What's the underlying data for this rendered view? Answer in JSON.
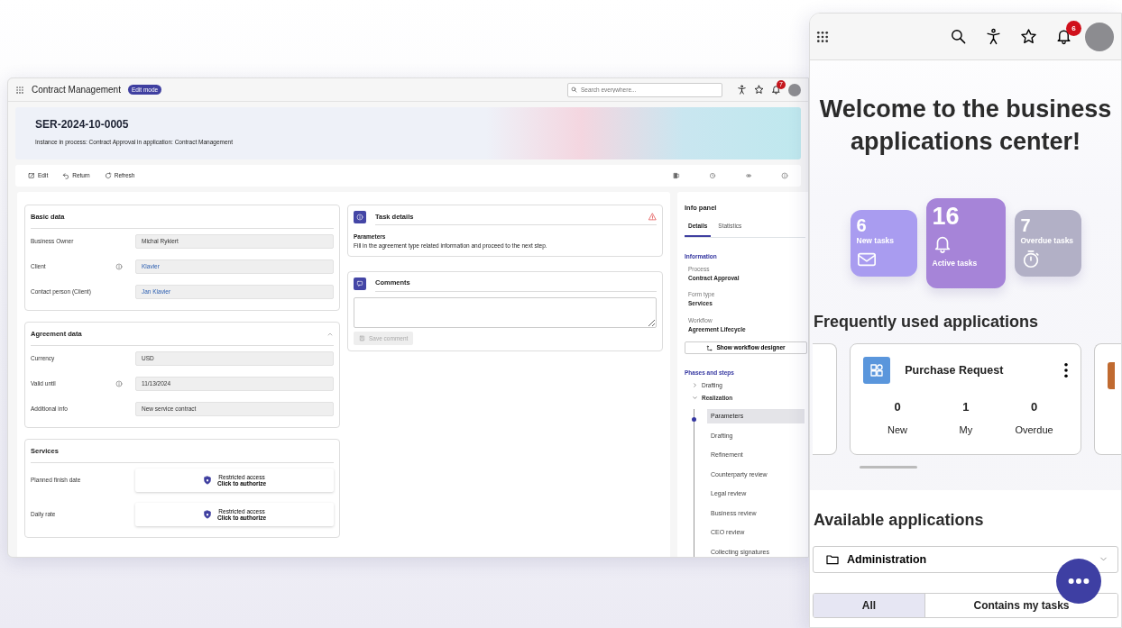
{
  "app_window": {
    "title": "Contract Management",
    "mode_badge": "Edit mode",
    "search": {
      "placeholder": "Search everywhere..."
    },
    "notification_count": "7"
  },
  "record": {
    "title": "SER-2024-10-0005",
    "subtitle": "Instance in process: Contract Approval in application: Contract Management"
  },
  "toolbar": [
    {
      "kind": "edit",
      "label": "Edit"
    },
    {
      "kind": "return",
      "label": "Return"
    },
    {
      "kind": "refresh",
      "label": "Refresh"
    }
  ],
  "sections": [
    {
      "title": "Basic data",
      "fields": [
        {
          "label": "Business Owner",
          "kind": "text",
          "info": false,
          "value": "Michal Rykiert"
        },
        {
          "label": "Client",
          "kind": "link",
          "info": true,
          "value": "Klavier"
        },
        {
          "label": "Contact person (Client)",
          "kind": "link",
          "info": false,
          "value": "Jan Klavier"
        }
      ]
    },
    {
      "title": "Agreement data",
      "expanded": true,
      "fields": [
        {
          "label": "Currency",
          "kind": "text",
          "info": false,
          "value": "USD"
        },
        {
          "label": "Valid until",
          "kind": "text",
          "info": true,
          "value": "11/13/2024"
        },
        {
          "label": "Additional info",
          "kind": "text",
          "info": false,
          "value": "New service contract"
        }
      ]
    },
    {
      "title": "Services",
      "fields": [
        {
          "label": "Planned finish date",
          "kind": "restricted",
          "info": false,
          "value": "Restricted access",
          "action": "Click to authorize"
        },
        {
          "label": "Daily rate",
          "kind": "restricted",
          "info": false,
          "value": "Restricted access",
          "action": "Click to authorize"
        }
      ]
    }
  ],
  "task_details": {
    "title": "Task details",
    "warning": true,
    "step": "Parameters",
    "text": "Fill in the agreement type related information and proceed to the next step."
  },
  "comments": {
    "title": "Comments",
    "save_button": "Save comment",
    "save_disabled": true
  },
  "info_panel": {
    "title": "Info panel",
    "tabs": [
      {
        "label": "Details",
        "selected": true
      },
      {
        "label": "Statistics",
        "selected": false
      }
    ],
    "information_heading": "Information",
    "properties": [
      {
        "label": "Process",
        "value": "Contract Approval"
      },
      {
        "label": "Form type",
        "value": "Services"
      },
      {
        "label": "Workflow",
        "value": "Agreement Lifecycle"
      }
    ],
    "designer_button": "Show workflow designer",
    "phases_heading": "Phases and steps",
    "phases": [
      {
        "label": "Drafting",
        "expanded": false
      },
      {
        "label": "Realization",
        "expanded": true,
        "children": [
          {
            "label": "Parameters",
            "selected": true
          },
          {
            "label": "Drafting",
            "selected": false
          },
          {
            "label": "Refinement",
            "selected": false
          },
          {
            "label": "Counterparty review",
            "selected": false
          },
          {
            "label": "Legal review",
            "selected": false
          },
          {
            "label": "Business review",
            "selected": false
          },
          {
            "label": "CEO review",
            "selected": false
          },
          {
            "label": "Collecting signatures",
            "selected": false
          }
        ]
      }
    ]
  },
  "portal": {
    "notification_count": "6",
    "welcome": "Welcome to the business applications center!",
    "task_tiles": [
      {
        "kind": "new",
        "count": "6",
        "label": "New tasks",
        "color": "#a99cf0",
        "selected": false
      },
      {
        "kind": "active",
        "count": "16",
        "label": "Active tasks",
        "color": "#a684d8",
        "selected": true
      },
      {
        "kind": "overdue",
        "count": "7",
        "label": "Overdue tasks",
        "color": "#b2b0c6",
        "selected": false
      }
    ],
    "frequent_heading": "Frequently used applications",
    "apps": [
      {
        "name": "Purchase Request",
        "stats": [
          {
            "value": "0",
            "label": "New"
          },
          {
            "value": "1",
            "label": "My"
          },
          {
            "value": "0",
            "label": "Overdue"
          }
        ]
      }
    ],
    "available_heading": "Available applications",
    "category": "Administration",
    "filters": [
      {
        "label": "All",
        "selected": true
      },
      {
        "label": "Contains my tasks",
        "selected": false
      }
    ]
  }
}
